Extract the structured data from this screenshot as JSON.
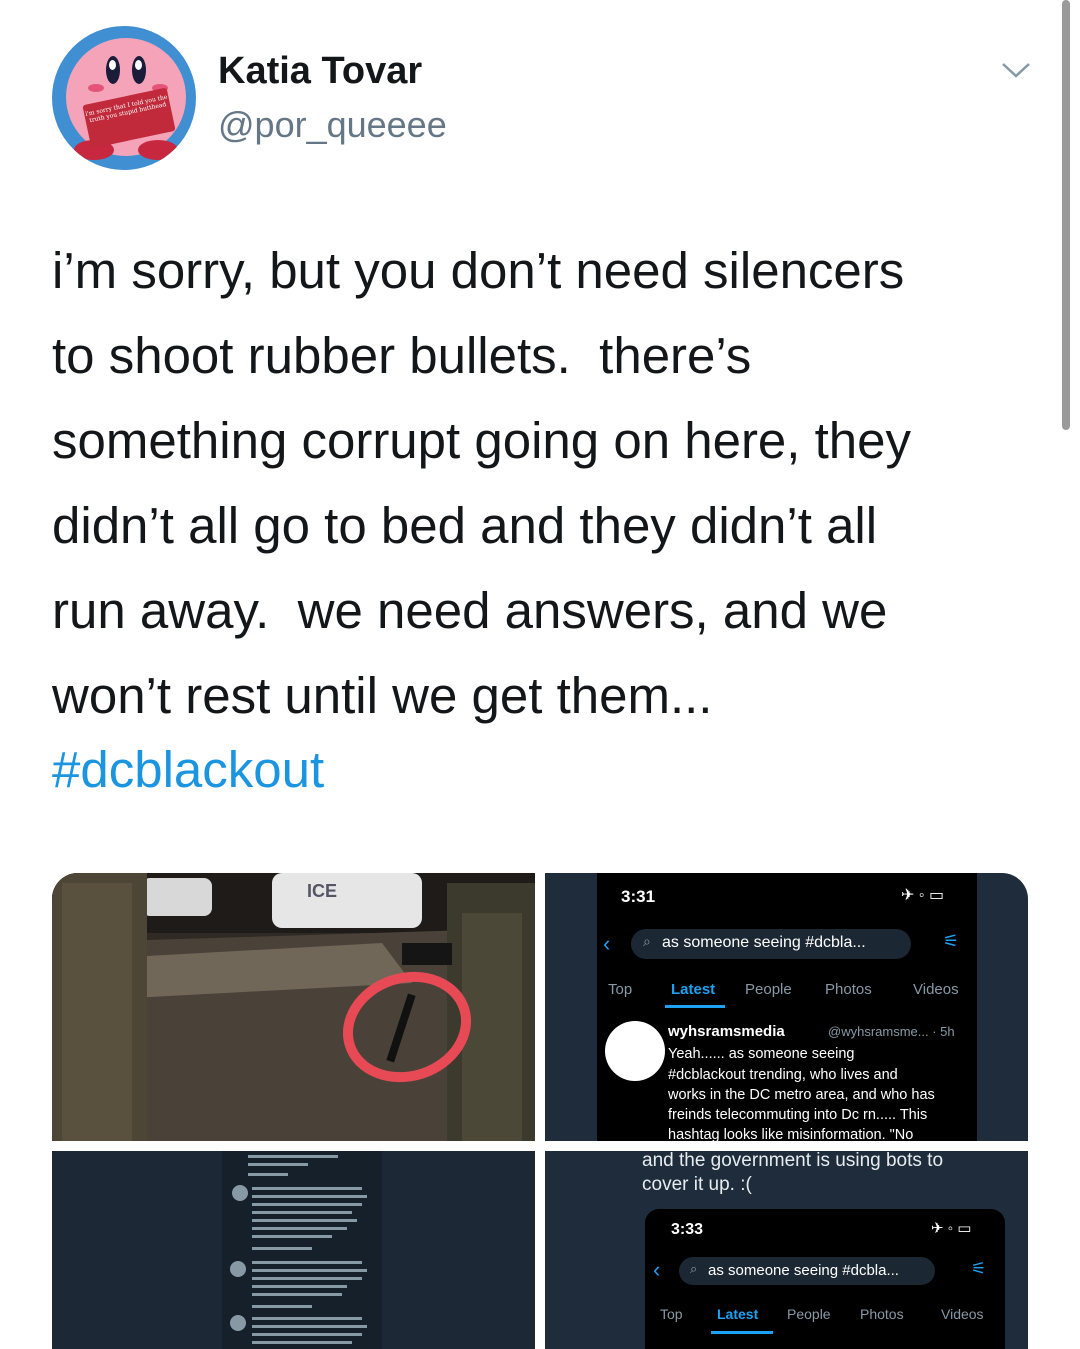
{
  "user": {
    "name": "Katia Tovar",
    "handle": "@por_queeee",
    "avatar_sign": "i'm sorry that I told you the truth you stupid butthead"
  },
  "tweet": {
    "text": "i’m sorry, but you don’t need silencers\nto shoot rubber bullets.  there’s\nsomething corrupt going on here, they\ndidn’t all go to bed and they didn’t all\nrun away.  we need answers, and we\nwon’t rest until we get them...",
    "hashtag": "#dcblackout"
  },
  "icons": {
    "menu": "chevron-down-icon"
  },
  "media": {
    "photo_sign": "ICE",
    "shot1": {
      "time": "3:31",
      "search": "as someone seeing #dcbla...",
      "tabs": [
        "Top",
        "Latest",
        "People",
        "Photos",
        "Videos"
      ],
      "post_user": "wyhsramsmedia",
      "post_meta": "@wyhsramsme... · 5h",
      "post_lines": [
        "Yeah...... as someone seeing",
        "#dcblackout trending, who lives and",
        "works in the DC metro area, and who has",
        "freinds telecommuting into Dc rn..... This",
        "hashtag looks like misinformation. \"No"
      ]
    },
    "shot2": {
      "caption": [
        "and the government is using bots to",
        "cover it up. :("
      ],
      "time": "3:33",
      "search": "as someone seeing #dcbla...",
      "tabs": [
        "Top",
        "Latest",
        "People",
        "Photos",
        "Videos"
      ]
    }
  },
  "colors": {
    "link": "#1b95e0",
    "secondary": "#657786",
    "circle": "#e84a55"
  }
}
